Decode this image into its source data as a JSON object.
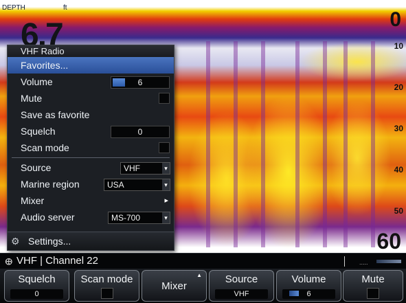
{
  "overlay": {
    "depth_label": "DEPTH",
    "units": "ft",
    "depth_value": "6.7",
    "scale_top": "0",
    "scale_bottom": "60",
    "scale_ticks": [
      "10",
      "20",
      "30",
      "40",
      "50"
    ]
  },
  "menu": {
    "title": "VHF Radio",
    "items": [
      {
        "label": "Favorites...",
        "selected": true
      },
      {
        "label": "Volume",
        "value": "6"
      },
      {
        "label": "Mute"
      },
      {
        "label": "Save as favorite"
      },
      {
        "label": "Squelch",
        "value": "0"
      },
      {
        "label": "Scan mode"
      },
      {
        "label": "Source",
        "value": "VHF"
      },
      {
        "label": "Marine region",
        "value": "USA"
      },
      {
        "label": "Mixer"
      },
      {
        "label": "Audio server",
        "value": "MS-700"
      }
    ],
    "settings_label": "Settings..."
  },
  "status": {
    "source": "VHF",
    "channel": "Channel 22",
    "dots": "....."
  },
  "softkeys": [
    {
      "label": "Squelch",
      "value": "0"
    },
    {
      "label": "Scan mode"
    },
    {
      "label": "Mixer"
    },
    {
      "label": "Source",
      "value": "VHF"
    },
    {
      "label": "Volume",
      "value": "6"
    },
    {
      "label": "Mute"
    }
  ],
  "colors": {
    "accent": "#2a4f98",
    "panel": "#1c1f24"
  }
}
